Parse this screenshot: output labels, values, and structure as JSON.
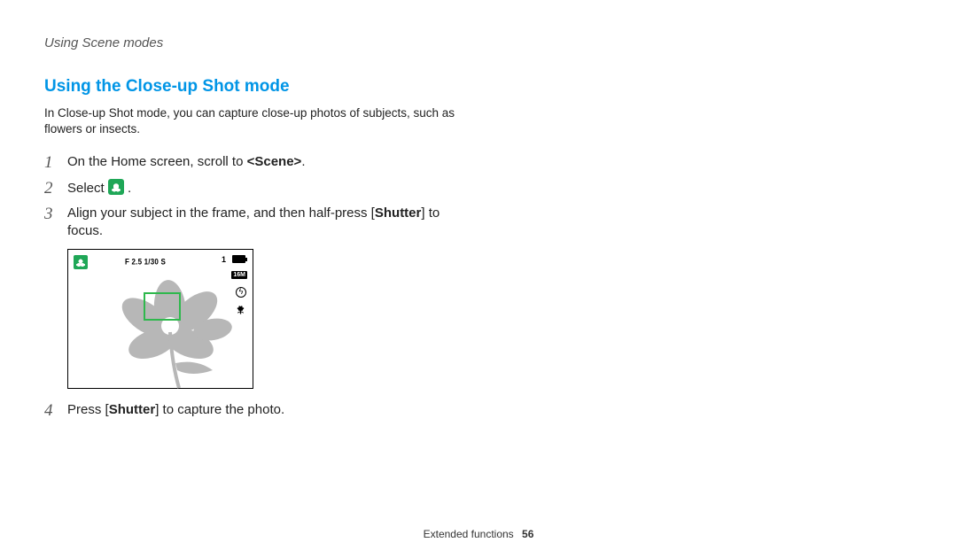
{
  "running_head": "Using Scene modes",
  "section_heading": "Using the Close-up Shot mode",
  "intro": "In Close-up Shot mode, you can capture close-up photos of subjects, such as flowers or insects.",
  "steps": {
    "s1": {
      "num": "1",
      "pre": "On the Home screen, scroll to ",
      "scene": "<Scene>",
      "post": "."
    },
    "s2": {
      "num": "2",
      "pre": "Select ",
      "post": " ."
    },
    "s3": {
      "num": "3",
      "pre": "Align your subject in the frame, and then half-press [",
      "shutter": "Shutter",
      "post": "] to focus."
    },
    "s4": {
      "num": "4",
      "pre": "Press [",
      "shutter": "Shutter",
      "post": "] to capture the photo."
    }
  },
  "camera": {
    "exposure": "F 2.5  1/30 S",
    "count": "1",
    "resolution": "16M"
  },
  "footer": {
    "section": "Extended functions",
    "page": "56"
  }
}
